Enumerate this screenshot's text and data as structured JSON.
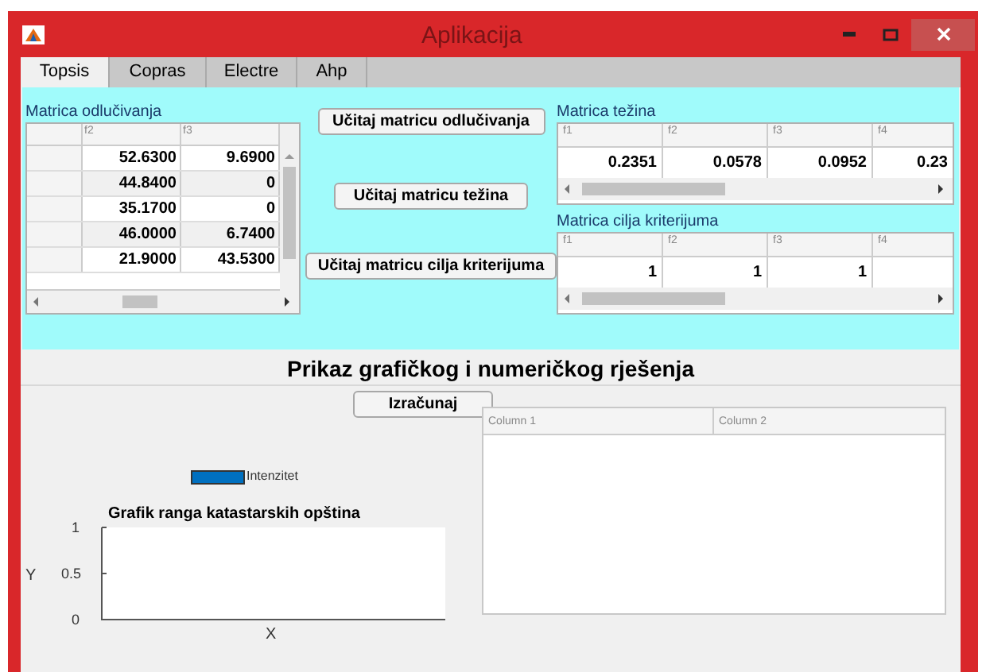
{
  "window": {
    "title": "Aplikacija"
  },
  "tabs": [
    {
      "label": "Topsis",
      "selected": true
    },
    {
      "label": "Copras",
      "selected": false
    },
    {
      "label": "Electre",
      "selected": false
    },
    {
      "label": "Ahp",
      "selected": false
    }
  ],
  "decision_matrix": {
    "label": "Matrica odlučivanja",
    "columns": [
      "f2",
      "f3"
    ],
    "rows": [
      [
        "52.6300",
        "9.6900"
      ],
      [
        "44.8400",
        "0"
      ],
      [
        "35.1700",
        "0"
      ],
      [
        "46.0000",
        "6.7400"
      ],
      [
        "21.9000",
        "43.5300"
      ]
    ]
  },
  "buttons": [
    "Učitaj matricu odlučivanja",
    "Učitaj matricu težina",
    "Učitaj matricu cilja kriterijuma"
  ],
  "weights_matrix": {
    "label": "Matrica težina",
    "columns": [
      "f1",
      "f2",
      "f3",
      "f4"
    ],
    "rows": [
      [
        "0.2351",
        "0.0578",
        "0.0952",
        "0.23"
      ]
    ]
  },
  "criteria_matrix": {
    "label": "Matrica cilja kriterijuma",
    "columns": [
      "f1",
      "f2",
      "f3",
      "f4"
    ],
    "rows": [
      [
        "1",
        "1",
        "1"
      ]
    ]
  },
  "results": {
    "heading": "Prikaz grafičkog i numeričkog rješenja",
    "button": "Izračunaj",
    "chart_data": {
      "type": "bar",
      "title": "Grafik ranga katastarskih opština",
      "xlabel": "X",
      "ylabel": "Y",
      "ylim": [
        0,
        1
      ],
      "yticks": [
        0,
        0.5,
        1
      ],
      "series": [
        {
          "name": "Intenzitet",
          "color": "#0070c0"
        }
      ]
    },
    "table": {
      "columns": [
        "Column 1",
        "Column 2"
      ]
    }
  }
}
